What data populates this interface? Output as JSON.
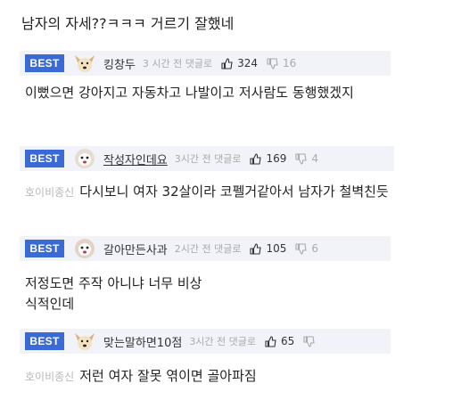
{
  "top_comment": {
    "text": "남자의 자세??ㅋㅋㅋ 거르기 잘했네"
  },
  "badge_label": "BEST",
  "comments": [
    {
      "user": "킹창두",
      "meta": "3 시간 전 댓글로",
      "likes": "324",
      "dislikes": "16",
      "body": "이뻤으면 강아지고 자동차고 나발이고 저사람도 동행했겠지",
      "prefix": ""
    },
    {
      "user": "작성자인데요",
      "meta": "3시간 전 댓글로",
      "likes": "169",
      "dislikes": "4",
      "body": "다시보니 여자 32살이라 코펠거같아서 남자가 철벽친듯",
      "prefix": "호이비종신"
    },
    {
      "user": "갈아만든사과",
      "meta": "2시간 전 댓글로",
      "likes": "105",
      "dislikes": "6",
      "body": "저정도면 주작 아니냐 너무 비상식적인데",
      "prefix": ""
    },
    {
      "user": "맞는말하면10점",
      "meta": "3시간 전 댓글로",
      "likes": "65",
      "dislikes": "",
      "body": "저런 여자 잘못 엮이면 골아파짐",
      "prefix": "호이비종신"
    }
  ],
  "colors": {
    "badge": "#3a6ad6",
    "header_bg": "#f1f3f8"
  }
}
